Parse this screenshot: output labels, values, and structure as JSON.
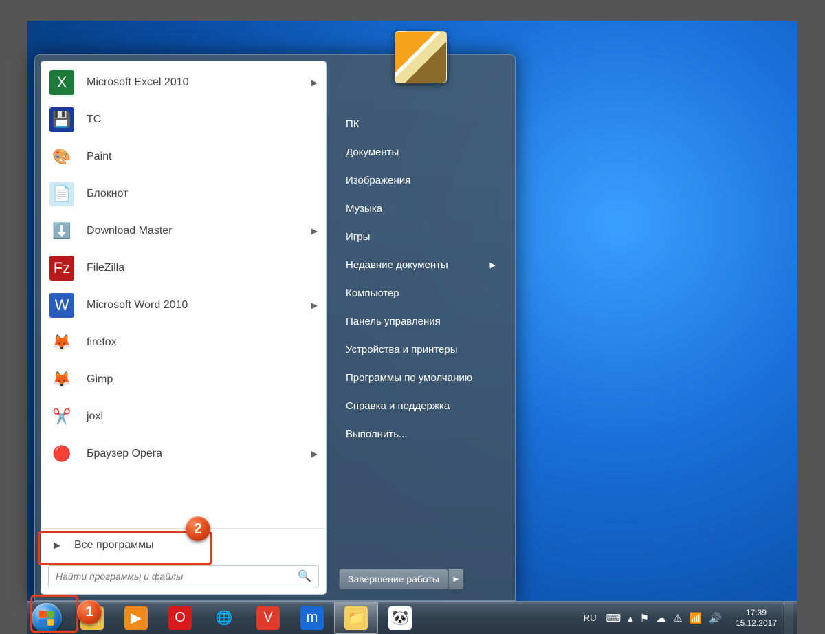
{
  "start_menu": {
    "programs": [
      {
        "label": "Microsoft Excel 2010",
        "icon_name": "excel-icon",
        "icon_bg": "#1e7a3a",
        "icon_txt": "X",
        "arrow": true
      },
      {
        "label": "TC",
        "icon_name": "tc-icon",
        "icon_bg": "#1a3a9a",
        "icon_txt": "💾",
        "arrow": false
      },
      {
        "label": "Paint",
        "icon_name": "paint-icon",
        "icon_bg": "transparent",
        "icon_txt": "🎨",
        "arrow": false
      },
      {
        "label": "Блокнот",
        "icon_name": "notepad-icon",
        "icon_bg": "#cfeaf5",
        "icon_txt": "📄",
        "arrow": false
      },
      {
        "label": "Download Master",
        "icon_name": "download-master-icon",
        "icon_bg": "transparent",
        "icon_txt": "⬇️",
        "arrow": true
      },
      {
        "label": "FileZilla",
        "icon_name": "filezilla-icon",
        "icon_bg": "#b61a1a",
        "icon_txt": "Fz",
        "arrow": false
      },
      {
        "label": "Microsoft Word 2010",
        "icon_name": "word-icon",
        "icon_bg": "#2a5dbb",
        "icon_txt": "W",
        "arrow": true
      },
      {
        "label": "firefox",
        "icon_name": "firefox-icon",
        "icon_bg": "transparent",
        "icon_txt": "🦊",
        "arrow": false
      },
      {
        "label": "Gimp",
        "icon_name": "gimp-icon",
        "icon_bg": "transparent",
        "icon_txt": "🦊",
        "arrow": false
      },
      {
        "label": "joxi",
        "icon_name": "joxi-icon",
        "icon_bg": "transparent",
        "icon_txt": "✂️",
        "arrow": false
      },
      {
        "label": "Браузер Opera",
        "icon_name": "opera-icon",
        "icon_bg": "transparent",
        "icon_txt": "🔴",
        "arrow": true
      }
    ],
    "all_programs_label": "Все программы",
    "search_placeholder": "Найти программы и файлы",
    "system_items": [
      {
        "label": "ПК",
        "submenu": false
      },
      {
        "label": "Документы",
        "submenu": false
      },
      {
        "label": "Изображения",
        "submenu": false
      },
      {
        "label": "Музыка",
        "submenu": false
      },
      {
        "label": "Игры",
        "submenu": false
      },
      {
        "label": "Недавние документы",
        "submenu": true
      },
      {
        "label": "Компьютер",
        "submenu": false
      },
      {
        "label": "Панель управления",
        "submenu": false
      },
      {
        "label": "Устройства и принтеры",
        "submenu": false
      },
      {
        "label": "Программы по умолчанию",
        "submenu": false
      },
      {
        "label": "Справка и поддержка",
        "submenu": false
      },
      {
        "label": "Выполнить...",
        "submenu": false
      }
    ],
    "shutdown_label": "Завершение работы"
  },
  "taskbar": {
    "pinned": [
      {
        "name": "explorer-icon",
        "bg": "#f0c040",
        "txt": "🗂"
      },
      {
        "name": "wmp-icon",
        "bg": "#f08a1a",
        "txt": "▶"
      },
      {
        "name": "opera-icon",
        "bg": "#d81a1a",
        "txt": "O"
      },
      {
        "name": "chrome-icon",
        "bg": "transparent",
        "txt": "🌐"
      },
      {
        "name": "vivaldi-icon",
        "bg": "#e03a2a",
        "txt": "V"
      },
      {
        "name": "maxthon-icon",
        "bg": "#1a6ad6",
        "txt": "m"
      },
      {
        "name": "file-explorer-icon",
        "bg": "#f5d060",
        "txt": "📁",
        "active": true
      },
      {
        "name": "panda-icon",
        "bg": "#fff",
        "txt": "🐼"
      }
    ],
    "tray_lang": "RU",
    "tray_time": "17:39",
    "tray_date": "15.12.2017"
  },
  "annotations": {
    "badge1": "1",
    "badge2": "2"
  }
}
